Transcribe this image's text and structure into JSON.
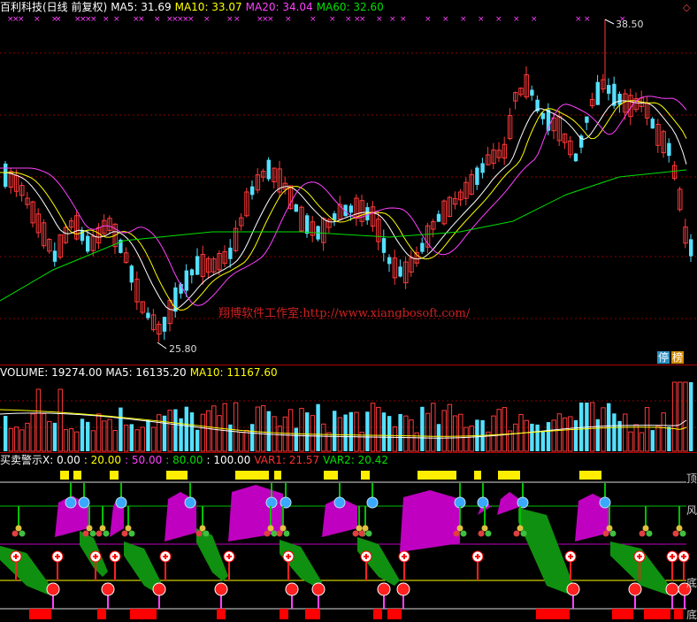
{
  "price_header": {
    "name": "百利科技(日线 前复权)",
    "ma5": "MA5: 31.69",
    "ma10": "MA10: 33.07",
    "ma20": "MA20: 34.04",
    "ma60": "MA60: 32.60"
  },
  "price_annotations": {
    "high": "38.50",
    "low": "25.80"
  },
  "watermark": "翔博软件工作室:http://www.xiangbosoft.com/",
  "buttons": {
    "ting": "停",
    "bang": "榜"
  },
  "volume_header": {
    "volume": "VOLUME: 19274.00",
    "ma5": "MA5: 16135.20",
    "ma10": "MA10: 11167.60"
  },
  "indicator_header": {
    "name": "买卖警示X",
    "v0": ": 0.00",
    "v20": ": 20.00",
    "v50": ": 50.00",
    "v80": ": 80.00",
    "v100": ": 100.00",
    "var1": "VAR1: 21.57",
    "var2": "VAR2: 20.42"
  },
  "indicator_labels": {
    "top": "顶",
    "wind": "风",
    "bottom": "底",
    "bottom2": "底"
  },
  "corner_icon": "◇",
  "colors": {
    "up": "#ff3a3a",
    "down": "#54e0ff",
    "ma5": "#ffffff",
    "ma10": "#ffff00",
    "ma20": "#ff40ff",
    "ma60": "#00e000",
    "magenta_band": "#c000c0",
    "green_band": "#109010",
    "yellow_bar": "#ffee00",
    "red_bar": "#ff0000"
  }
}
